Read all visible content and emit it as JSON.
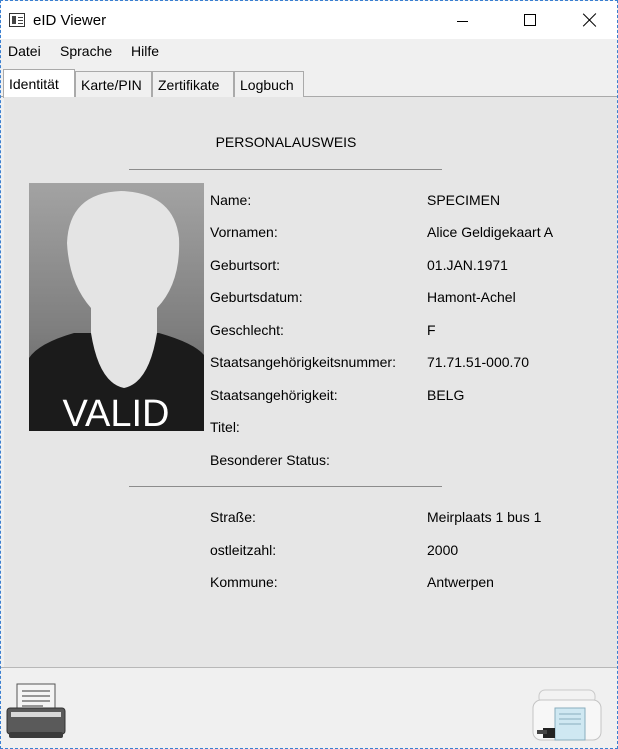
{
  "window": {
    "title": "eID Viewer"
  },
  "menu": {
    "items": [
      "Datei",
      "Sprache",
      "Hilfe"
    ]
  },
  "tabs": [
    {
      "label": "Identität",
      "active": true
    },
    {
      "label": "Karte/PIN",
      "active": false
    },
    {
      "label": "Zertifikate",
      "active": false
    },
    {
      "label": "Logbuch",
      "active": false
    }
  ],
  "card": {
    "heading": "PERSONALAUSWEIS",
    "photo_overlay": "VALID",
    "identity": [
      {
        "label": "Name:",
        "value": "SPECIMEN"
      },
      {
        "label": "Vornamen:",
        "value": "Alice Geldigekaart A"
      },
      {
        "label": "Geburtsort:",
        "value": "01.JAN.1971"
      },
      {
        "label": "Geburtsdatum:",
        "value": "Hamont-Achel"
      },
      {
        "label": "Geschlecht:",
        "value": "F"
      },
      {
        "label": "Staatsangehörigkeitsnummer:",
        "value": "71.71.51-000.70"
      },
      {
        "label": "Staatsangehörigkeit:",
        "value": "BELG"
      },
      {
        "label": "Titel:",
        "value": ""
      },
      {
        "label": "Besonderer Status:",
        "value": ""
      }
    ],
    "address": [
      {
        "label": "Straße:",
        "value": "Meirplaats 1 bus 1"
      },
      {
        "label": "ostleitzahl:",
        "value": "2000"
      },
      {
        "label": "Kommune:",
        "value": "Antwerpen"
      }
    ]
  },
  "icons": {
    "app": "id-card-icon",
    "print": "printer-icon",
    "reader": "card-reader-icon"
  }
}
